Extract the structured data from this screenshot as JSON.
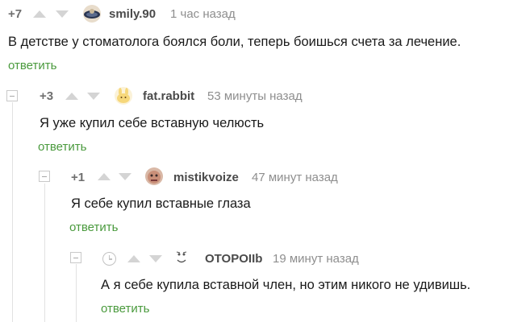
{
  "comments": [
    {
      "rating": "+7",
      "username": "smily.90",
      "time": "1 час назад",
      "text": "В детстве у стоматолога боялся боли, теперь боишься счета за лечение.",
      "reply_label": "ответить",
      "avatar_icon": "planet-avatar-icon"
    },
    {
      "rating": "+3",
      "username": "fat.rabbit",
      "time": "53 минуты назад",
      "text": "Я уже купил себе вставную челюсть",
      "reply_label": "ответить",
      "avatar_icon": "rabbit-avatar-icon"
    },
    {
      "rating": "+1",
      "username": "mistikvoize",
      "time": "47 минут назад",
      "text": "Я себе купил вставные глаза",
      "reply_label": "ответить",
      "avatar_icon": "face-avatar-icon"
    },
    {
      "rating": "",
      "username": "OTOPOIIb",
      "time": "19 минут назад",
      "text": "А я себе купила вставной член, но этим никого не удивишь.",
      "reply_label": "ответить",
      "avatar_icon": "doodle-avatar-icon",
      "pending_icon": "clock-icon"
    }
  ],
  "colors": {
    "reply_link": "#4a9a3d",
    "arrow": "#d4d4d4",
    "thread_line": "#e2e2e2",
    "meta_text": "#8e8e8e"
  }
}
